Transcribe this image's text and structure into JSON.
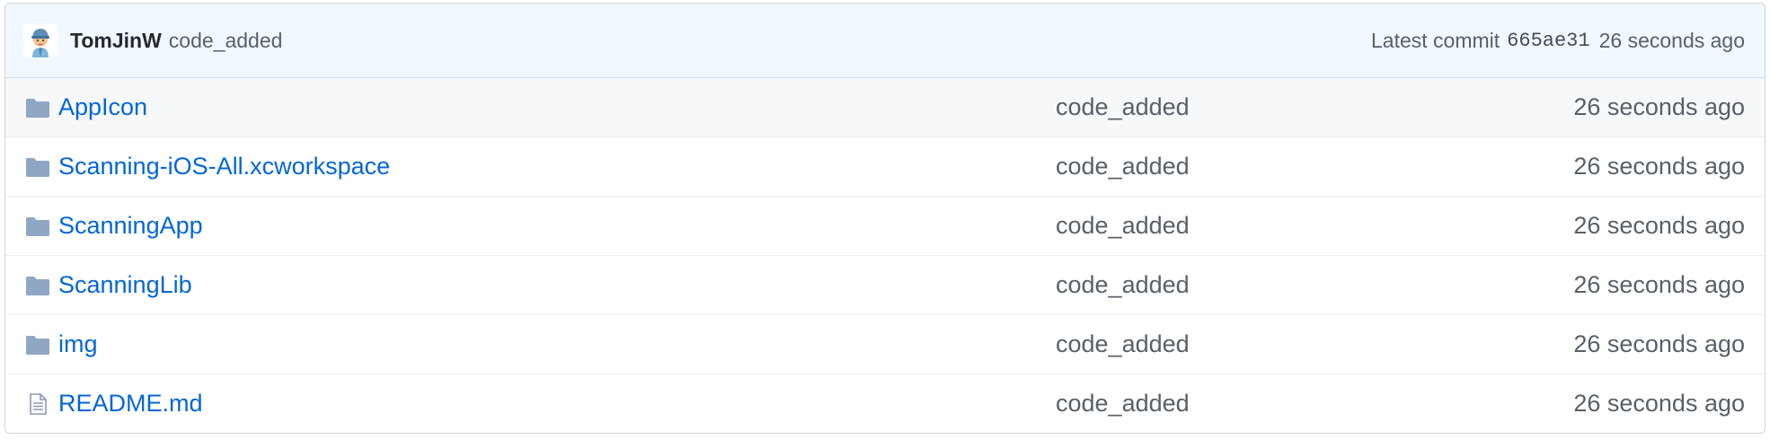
{
  "commit": {
    "author": "TomJinW",
    "message": "code_added",
    "latest_label": "Latest commit",
    "sha": "665ae31",
    "age": "26 seconds ago"
  },
  "files": [
    {
      "name": "AppIcon",
      "type": "directory",
      "icon": "folder-icon",
      "commit_message": "code_added",
      "age": "26 seconds ago"
    },
    {
      "name": "Scanning-iOS-All.xcworkspace",
      "type": "directory",
      "icon": "folder-icon",
      "commit_message": "code_added",
      "age": "26 seconds ago"
    },
    {
      "name": "ScanningApp",
      "type": "directory",
      "icon": "folder-icon",
      "commit_message": "code_added",
      "age": "26 seconds ago"
    },
    {
      "name": "ScanningLib",
      "type": "directory",
      "icon": "folder-icon",
      "commit_message": "code_added",
      "age": "26 seconds ago"
    },
    {
      "name": "img",
      "type": "directory",
      "icon": "folder-icon",
      "commit_message": "code_added",
      "age": "26 seconds ago"
    },
    {
      "name": "README.md",
      "type": "file",
      "icon": "file-text-icon",
      "commit_message": "code_added",
      "age": "26 seconds ago"
    }
  ],
  "colors": {
    "link": "#0366d6",
    "muted": "#586069",
    "commit_bar_bg": "#f1f8ff",
    "folder_icon": "#79b8ff"
  }
}
